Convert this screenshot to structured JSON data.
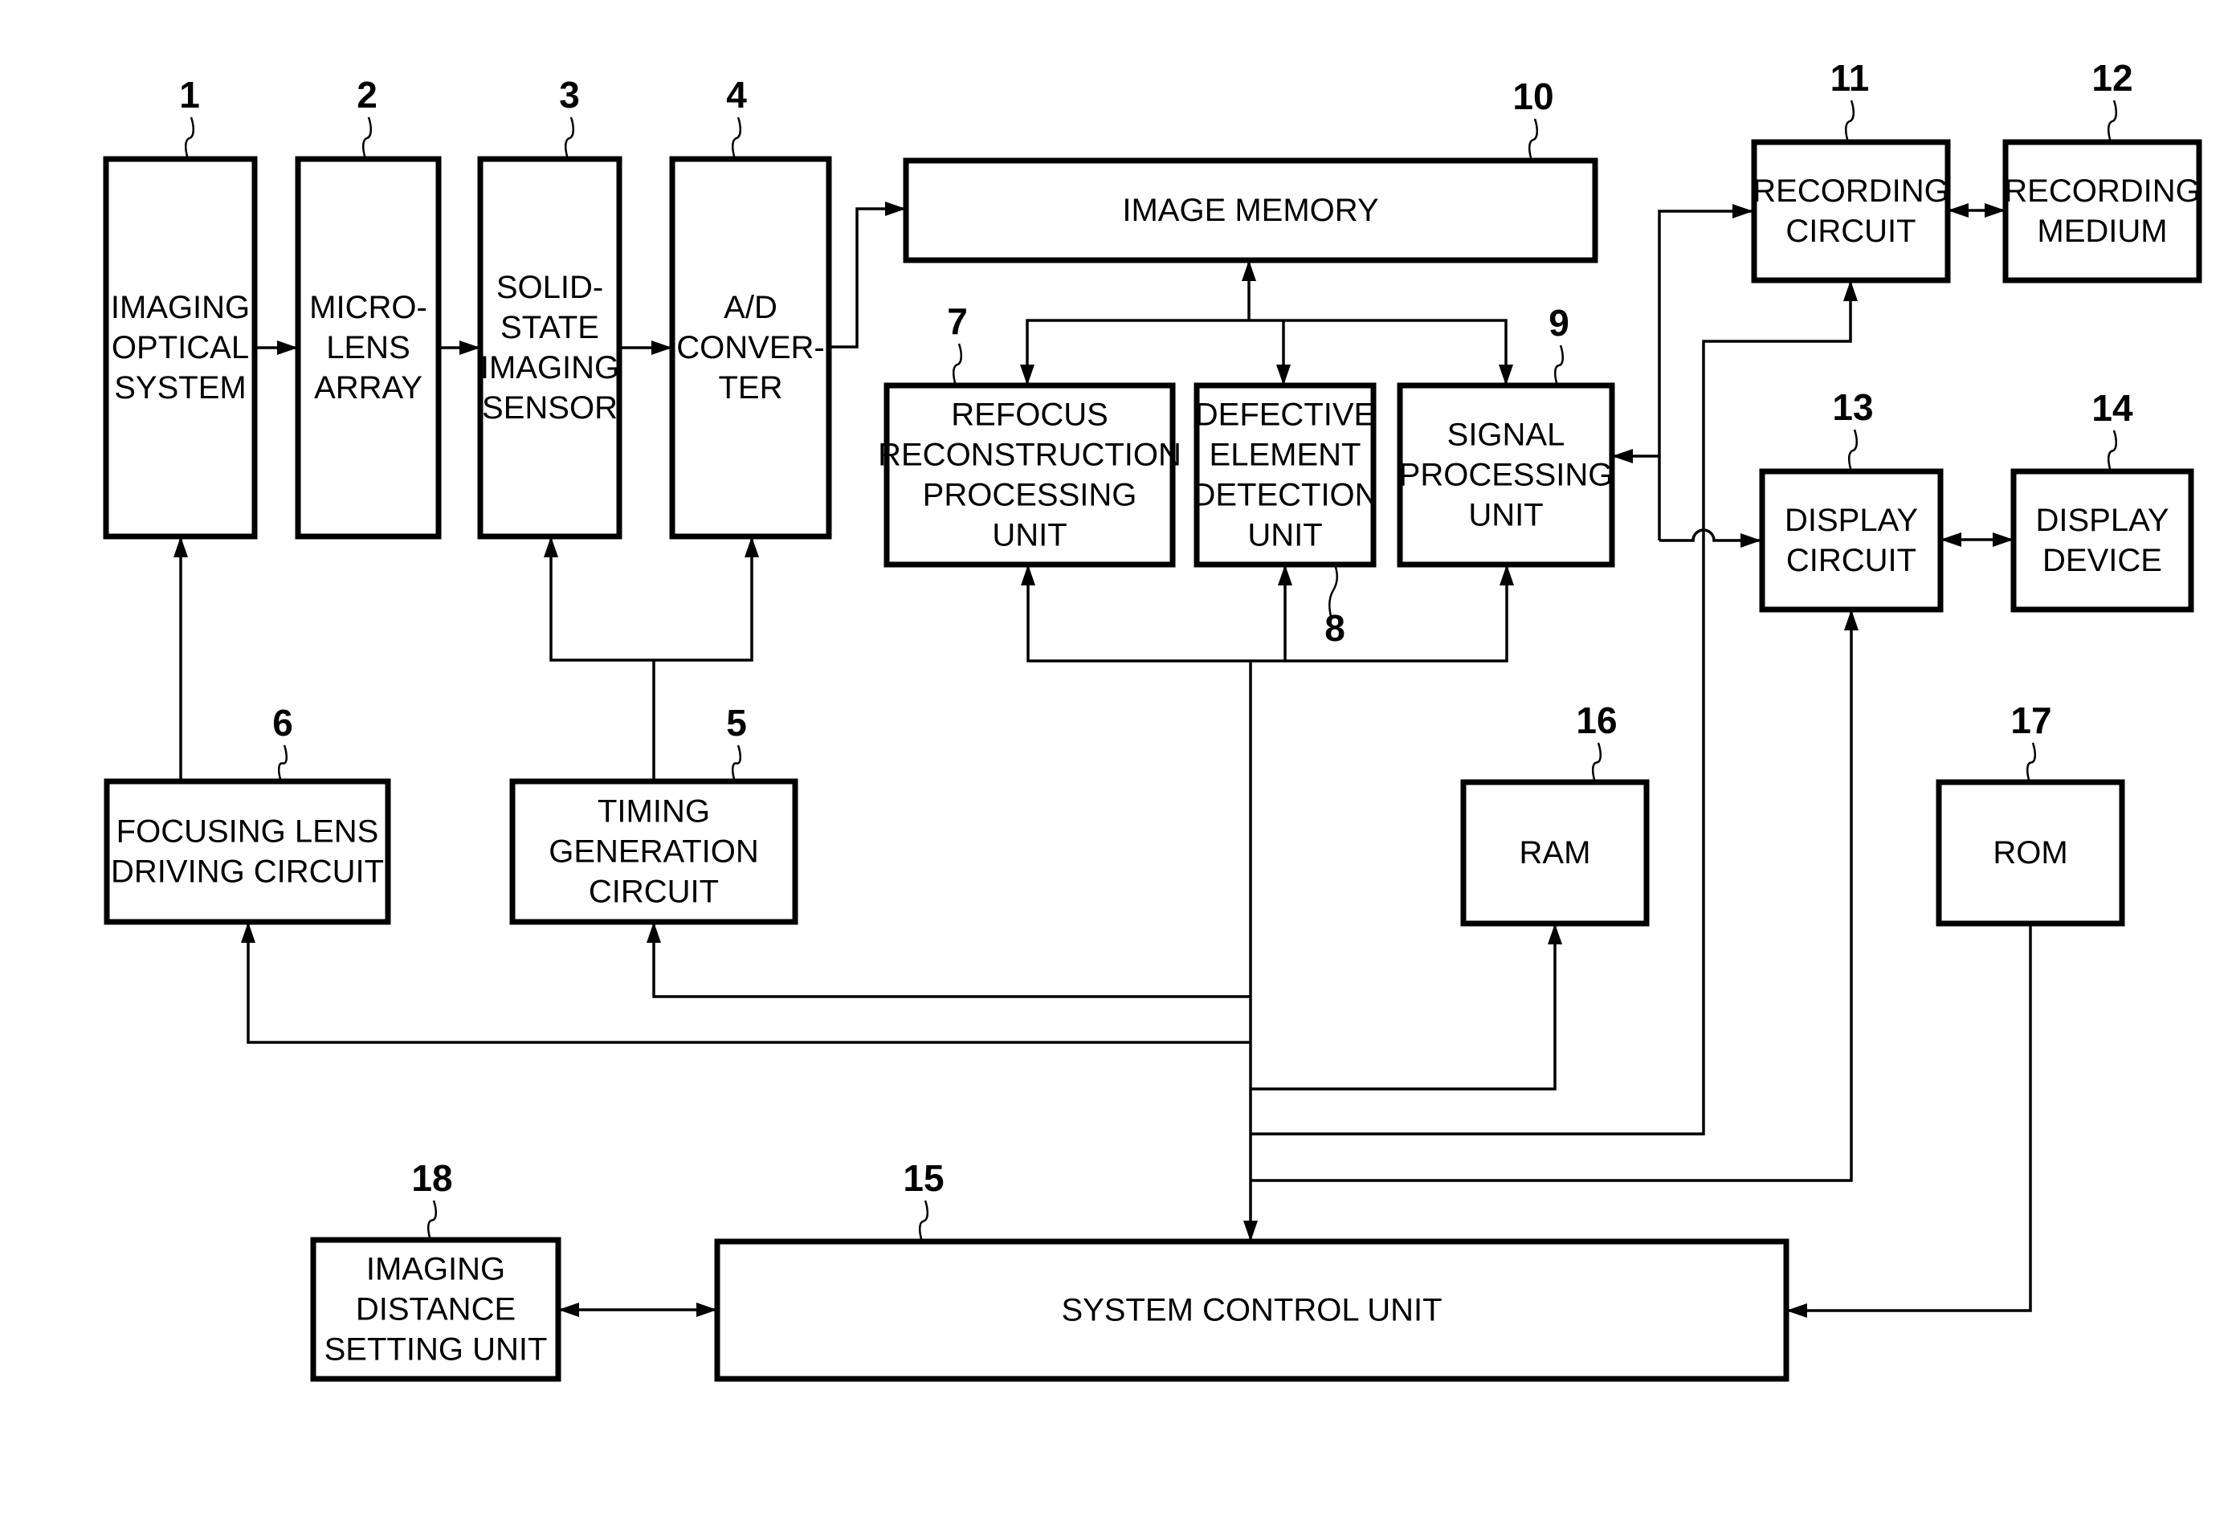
{
  "figure": {
    "type": "block-diagram",
    "blocks": [
      {
        "id": "1",
        "ref": "1",
        "label": [
          "IMAGING",
          "OPTICAL",
          "SYSTEM"
        ]
      },
      {
        "id": "2",
        "ref": "2",
        "label": [
          "MICRO-",
          "LENS",
          "ARRAY"
        ]
      },
      {
        "id": "3",
        "ref": "3",
        "label": [
          "SOLID-",
          "STATE",
          "IMAGING",
          "SENSOR"
        ]
      },
      {
        "id": "4",
        "ref": "4",
        "label": [
          "A/D",
          "CONVER-",
          "TER"
        ]
      },
      {
        "id": "5",
        "ref": "5",
        "label": [
          "TIMING",
          "GENERATION",
          "CIRCUIT"
        ]
      },
      {
        "id": "6",
        "ref": "6",
        "label": [
          "FOCUSING LENS",
          "DRIVING CIRCUIT"
        ]
      },
      {
        "id": "7",
        "ref": "7",
        "label": [
          "REFOCUS",
          "RECONSTRUCTION",
          "PROCESSING",
          "UNIT"
        ]
      },
      {
        "id": "8",
        "ref": "8",
        "label": [
          "DEFECTIVE",
          "ELEMENT",
          "DETECTION",
          "UNIT"
        ]
      },
      {
        "id": "9",
        "ref": "9",
        "label": [
          "SIGNAL",
          "PROCESSING",
          "UNIT"
        ]
      },
      {
        "id": "10",
        "ref": "10",
        "label": [
          "IMAGE MEMORY"
        ]
      },
      {
        "id": "11",
        "ref": "11",
        "label": [
          "RECORDING",
          "CIRCUIT"
        ]
      },
      {
        "id": "12",
        "ref": "12",
        "label": [
          "RECORDING",
          "MEDIUM"
        ]
      },
      {
        "id": "13",
        "ref": "13",
        "label": [
          "DISPLAY",
          "CIRCUIT"
        ]
      },
      {
        "id": "14",
        "ref": "14",
        "label": [
          "DISPLAY",
          "DEVICE"
        ]
      },
      {
        "id": "15",
        "ref": "15",
        "label": [
          "SYSTEM CONTROL UNIT"
        ]
      },
      {
        "id": "16",
        "ref": "16",
        "label": [
          "RAM"
        ]
      },
      {
        "id": "17",
        "ref": "17",
        "label": [
          "ROM"
        ]
      },
      {
        "id": "18",
        "ref": "18",
        "label": [
          "IMAGING",
          "DISTANCE",
          "SETTING UNIT"
        ]
      }
    ],
    "connections": [
      {
        "from": "1",
        "to": "2",
        "direction": "forward"
      },
      {
        "from": "2",
        "to": "3",
        "direction": "forward"
      },
      {
        "from": "3",
        "to": "4",
        "direction": "forward"
      },
      {
        "from": "4",
        "to": "10",
        "direction": "forward"
      },
      {
        "from": "5",
        "to": "3",
        "direction": "forward"
      },
      {
        "from": "5",
        "to": "4",
        "direction": "forward"
      },
      {
        "from": "6",
        "to": "1",
        "direction": "forward"
      },
      {
        "from": "10",
        "to": "7",
        "direction": "bidirectional-bus"
      },
      {
        "from": "10",
        "to": "8",
        "direction": "bidirectional-bus"
      },
      {
        "from": "10",
        "to": "9",
        "direction": "bidirectional-bus"
      },
      {
        "from": "15",
        "to": "7",
        "direction": "bus"
      },
      {
        "from": "15",
        "to": "8",
        "direction": "bus"
      },
      {
        "from": "15",
        "to": "9",
        "direction": "bus"
      },
      {
        "from": "15",
        "to": "5",
        "direction": "bus"
      },
      {
        "from": "15",
        "to": "6",
        "direction": "bus"
      },
      {
        "from": "15",
        "to": "16",
        "direction": "bus"
      },
      {
        "from": "15",
        "to": "11",
        "direction": "bus"
      },
      {
        "from": "15",
        "to": "13",
        "direction": "bus"
      },
      {
        "from": "9",
        "to": "11",
        "direction": "forward"
      },
      {
        "from": "9",
        "to": "13",
        "direction": "forward"
      },
      {
        "from": "11",
        "to": "12",
        "direction": "bidirectional"
      },
      {
        "from": "13",
        "to": "14",
        "direction": "bidirectional"
      },
      {
        "from": "17",
        "to": "15",
        "direction": "forward"
      },
      {
        "from": "18",
        "to": "15",
        "direction": "bidirectional"
      }
    ]
  }
}
